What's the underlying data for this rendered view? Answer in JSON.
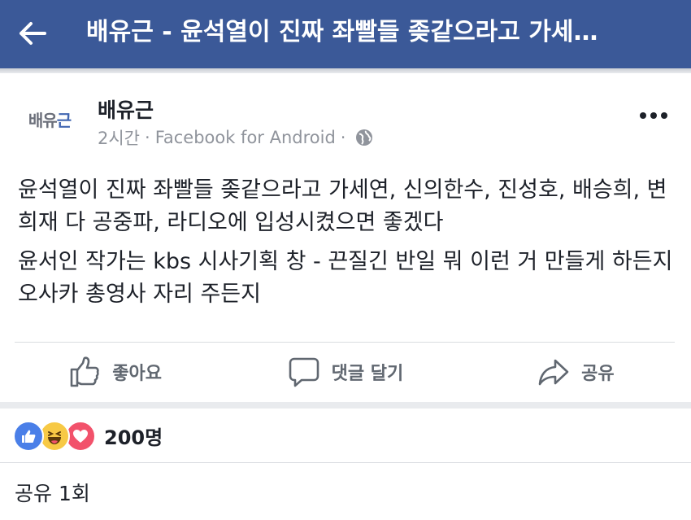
{
  "topbar": {
    "back_icon": "arrow-left-icon",
    "title": "배유근 - 윤석열이 진짜 좌빨들 좆같으라고 가세…",
    "background": "#3b5998"
  },
  "post": {
    "avatar_text_1": "배유",
    "avatar_text_2": "근",
    "author": "배유근",
    "time": "2시간",
    "separator_1": "·",
    "source": "Facebook for Android",
    "separator_2": "·",
    "privacy_icon": "globe-icon",
    "more_icon": "more-dots-icon",
    "paragraphs": [
      "윤석열이 진짜 좌빨들 좆같으라고 가세연, 신의한수, 진성호, 배승희, 변희재 다 공중파, 라디오에 입성시켰으면 좋겠다",
      "윤서인 작가는 kbs 시사기획 창 - 끈질긴 반일 뭐 이런 거 만들게 하든지 오사카 총영사 자리 주든지"
    ]
  },
  "actions": {
    "like_label": "좋아요",
    "like_icon": "thumbs-up-icon",
    "comment_label": "댓글 달기",
    "comment_icon": "comment-bubble-icon",
    "share_label": "공유",
    "share_icon": "share-arrow-icon"
  },
  "reactions": {
    "icons": [
      "like-reaction-icon",
      "haha-reaction-icon",
      "love-reaction-icon"
    ],
    "count": "200명"
  },
  "shares": {
    "label": "공유 1회"
  }
}
